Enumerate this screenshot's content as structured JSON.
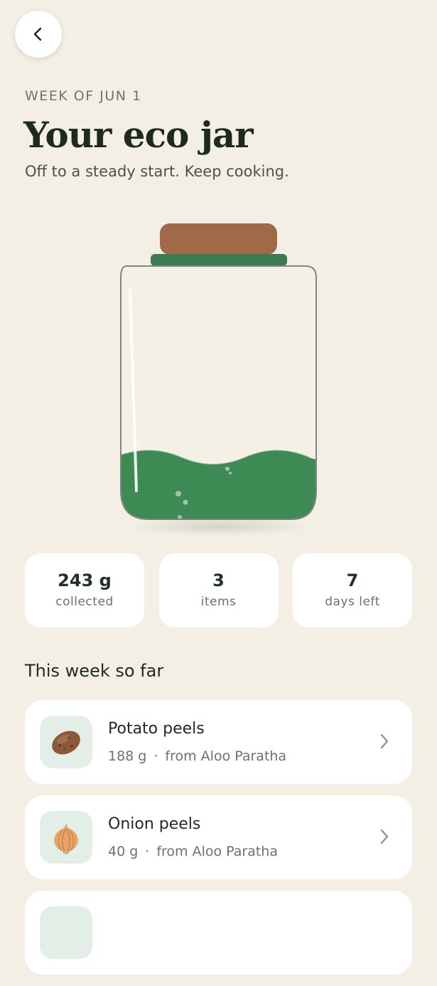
{
  "header": {
    "back_icon": "chevron-left-icon",
    "eyebrow": "WEEK OF JUN 1",
    "title": "Your eco jar",
    "subtitle": "Off to a steady start. Keep cooking."
  },
  "jar": {
    "fill_fraction": 0.25,
    "colors": {
      "lid": "#a06a48",
      "band": "#3c7a52",
      "liquid": "#3d8a55",
      "glass": "#f4f0e6"
    }
  },
  "stats": [
    {
      "value": "243 g",
      "label": "collected"
    },
    {
      "value": "3",
      "label": "items"
    },
    {
      "value": "7",
      "label": "days left"
    }
  ],
  "section": {
    "title": "This week so far"
  },
  "items": [
    {
      "name": "Potato peels",
      "weight": "188 g",
      "separator": "·",
      "source": "from Aloo Paratha",
      "icon": "potato-icon"
    },
    {
      "name": "Onion peels",
      "weight": "40 g",
      "separator": "·",
      "source": "from Aloo Paratha",
      "icon": "onion-icon"
    }
  ],
  "theme": {
    "background": "#f3efe4",
    "card": "#ffffff",
    "accent": "#3d8a55",
    "thumb_bg": "#e3efe6"
  }
}
